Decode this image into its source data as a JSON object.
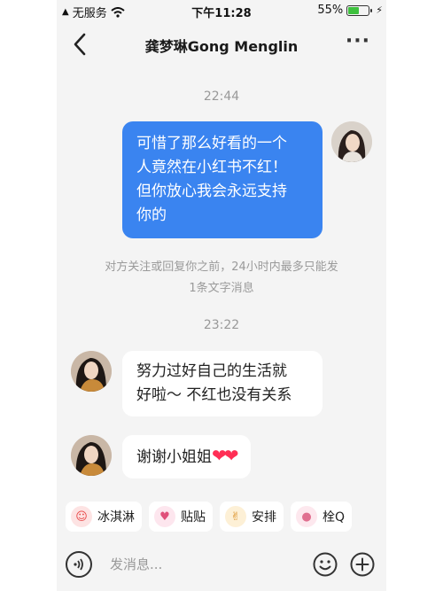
{
  "status_bar": {
    "carrier": "无服务",
    "time": "下午11:28",
    "battery": "55%",
    "battery_level": 0.55
  },
  "header": {
    "title": "龚梦琳Gong Menglin",
    "more": "···"
  },
  "messages": [
    {
      "type": "timestamp",
      "text": "22:44"
    },
    {
      "type": "sent",
      "lines": [
        "可惜了那么好看的一个",
        "人竟然在小红书不红！",
        "但你放心我会永远支持",
        "你的"
      ]
    },
    {
      "type": "notice",
      "lines": [
        "对方关注或回复你之前，24小时内最多只能发",
        "1条文字消息"
      ]
    },
    {
      "type": "timestamp",
      "text": "23:22"
    },
    {
      "type": "received",
      "lines": [
        "努力过好自己的生活就",
        "好啦～ 不红也没有关系"
      ]
    },
    {
      "type": "received",
      "text": "谢谢小姐姐",
      "emoji": "❤❤"
    }
  ],
  "quick_replies": [
    {
      "label": "冰淇淋",
      "icon": "ice-cream-sticker-icon",
      "color": "#e84a4a"
    },
    {
      "label": "贴贴",
      "icon": "hug-sticker-icon",
      "color": "#f07a9a"
    },
    {
      "label": "安排",
      "icon": "thumbs-up-sticker-icon",
      "color": "#f0b040"
    },
    {
      "label": "栓Q",
      "icon": "pig-sticker-icon",
      "color": "#f3a6b8"
    }
  ],
  "input": {
    "placeholder": "发消息..."
  },
  "colors": {
    "sent_bubble": "#3a84f0",
    "background": "#f4f4f4",
    "heart": "#ff2e55"
  }
}
